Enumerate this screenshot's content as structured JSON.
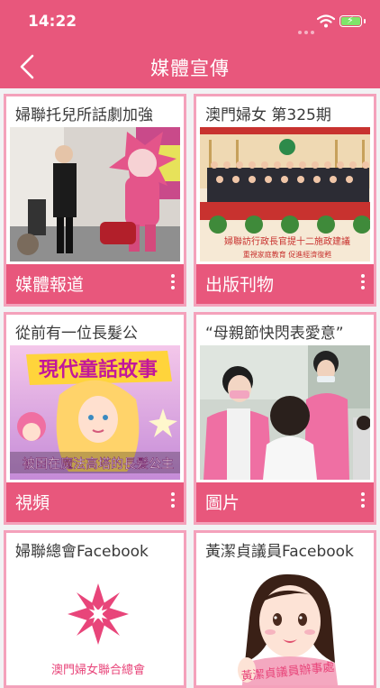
{
  "status_bar": {
    "time": "14:22"
  },
  "nav": {
    "title": "媒體宣傳"
  },
  "cards": [
    {
      "title": "婦聯托兒所話劇加強",
      "category": "媒體報道",
      "image": "mascot-performance-photo"
    },
    {
      "title": "澳門婦女 第325期",
      "category": "出版刊物",
      "image": "group-photo-magazine-cover",
      "image_caption": "婦聯訪行政長官提十二施政建議",
      "image_subcaption": "重視家庭教育 促進經濟復甦"
    },
    {
      "title": "從前有一位長髮公",
      "category": "視頻",
      "image": "fairy-tale-video-thumbnail",
      "image_title": "現代童話故事",
      "image_caption": "被困在魔法高塔的長髮公主"
    },
    {
      "title": "“母親節快閃表愛意”",
      "category": "圖片",
      "image": "mothers-day-photo"
    },
    {
      "title": "婦聯總會Facebook",
      "image": "federation-logo",
      "logo_text": "澳門婦女聯合總會"
    },
    {
      "title": "黃潔貞議員Facebook",
      "image": "legislator-cartoon",
      "logo_text": "黃潔貞議員辦事處"
    }
  ],
  "colors": {
    "primary": "#e8577c",
    "card_border": "#f4a1bb",
    "background": "#f2f2f4"
  }
}
